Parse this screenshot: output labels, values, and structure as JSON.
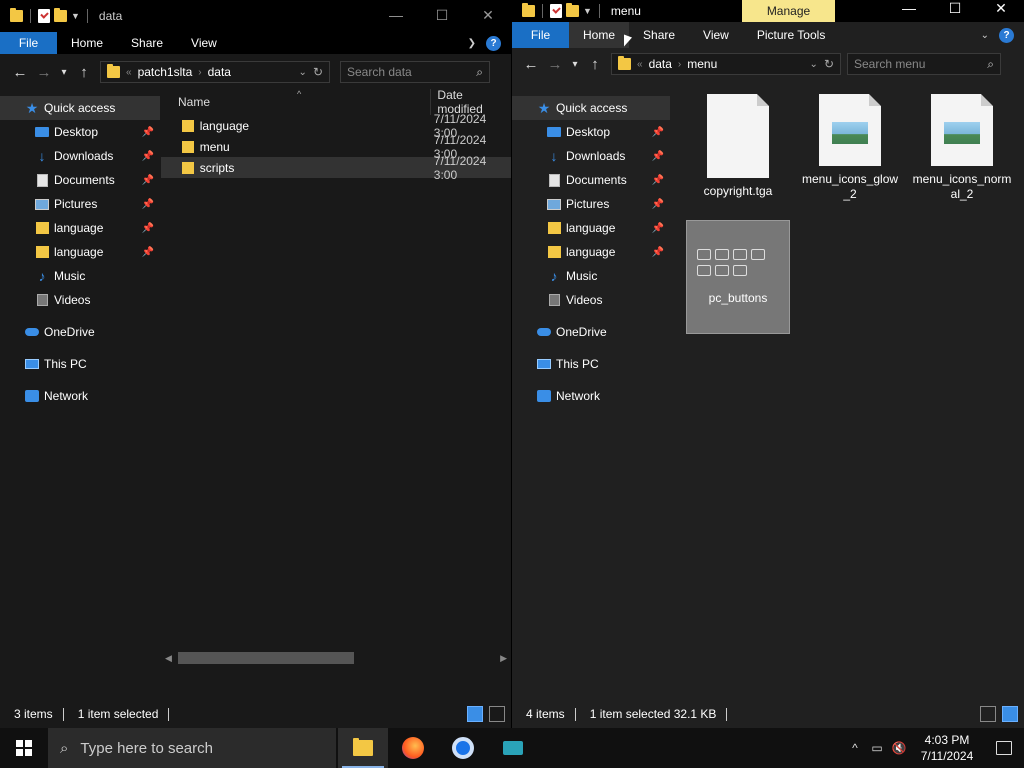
{
  "left_window": {
    "title": "data",
    "tabs": {
      "file": "File",
      "home": "Home",
      "share": "Share",
      "view": "View"
    },
    "address": {
      "parent": "patch1slta",
      "current": "data"
    },
    "search_placeholder": "Search data",
    "nav": {
      "quick_access": "Quick access",
      "items": [
        {
          "label": "Desktop",
          "icon": "desktop-icon"
        },
        {
          "label": "Downloads",
          "icon": "downloads-icon"
        },
        {
          "label": "Documents",
          "icon": "documents-icon"
        },
        {
          "label": "Pictures",
          "icon": "pictures-icon"
        },
        {
          "label": "language",
          "icon": "folder-icon"
        },
        {
          "label": "language",
          "icon": "folder-icon"
        },
        {
          "label": "Music",
          "icon": "music-icon"
        },
        {
          "label": "Videos",
          "icon": "videos-icon"
        }
      ],
      "onedrive": "OneDrive",
      "this_pc": "This PC",
      "network": "Network"
    },
    "columns": {
      "name": "Name",
      "date": "Date modified"
    },
    "files": [
      {
        "name": "language",
        "date": "7/11/2024 3:00"
      },
      {
        "name": "menu",
        "date": "7/11/2024 3:00"
      },
      {
        "name": "scripts",
        "date": "7/11/2024 3:00"
      }
    ],
    "status": {
      "count": "3 items",
      "selected": "1 item selected"
    }
  },
  "right_window": {
    "title": "menu",
    "contextual_tab": "Manage",
    "tabs": {
      "file": "File",
      "home": "Home",
      "share": "Share",
      "view": "View",
      "picture_tools": "Picture Tools"
    },
    "address": {
      "overflow": "«",
      "parent": "data",
      "current": "menu"
    },
    "search_placeholder": "Search menu",
    "nav": {
      "quick_access": "Quick access",
      "items": [
        {
          "label": "Desktop",
          "icon": "desktop-icon"
        },
        {
          "label": "Downloads",
          "icon": "downloads-icon"
        },
        {
          "label": "Documents",
          "icon": "documents-icon"
        },
        {
          "label": "Pictures",
          "icon": "pictures-icon"
        },
        {
          "label": "language",
          "icon": "folder-icon"
        },
        {
          "label": "language",
          "icon": "folder-icon"
        },
        {
          "label": "Music",
          "icon": "music-icon"
        },
        {
          "label": "Videos",
          "icon": "videos-icon"
        }
      ],
      "onedrive": "OneDrive",
      "this_pc": "This PC",
      "network": "Network"
    },
    "files": [
      {
        "name": "copyright.tga"
      },
      {
        "name": "menu_icons_glow_2"
      },
      {
        "name": "menu_icons_normal_2"
      },
      {
        "name": "pc_buttons"
      }
    ],
    "status": {
      "count": "4 items",
      "selected": "1 item selected  32.1 KB"
    }
  },
  "taskbar": {
    "search_placeholder": "Type here to search",
    "time": "4:03 PM",
    "date": "7/11/2024"
  },
  "colors": {
    "accent": "#1a6fc5",
    "folder": "#f3c744",
    "manage_tab": "#f7e68c"
  }
}
